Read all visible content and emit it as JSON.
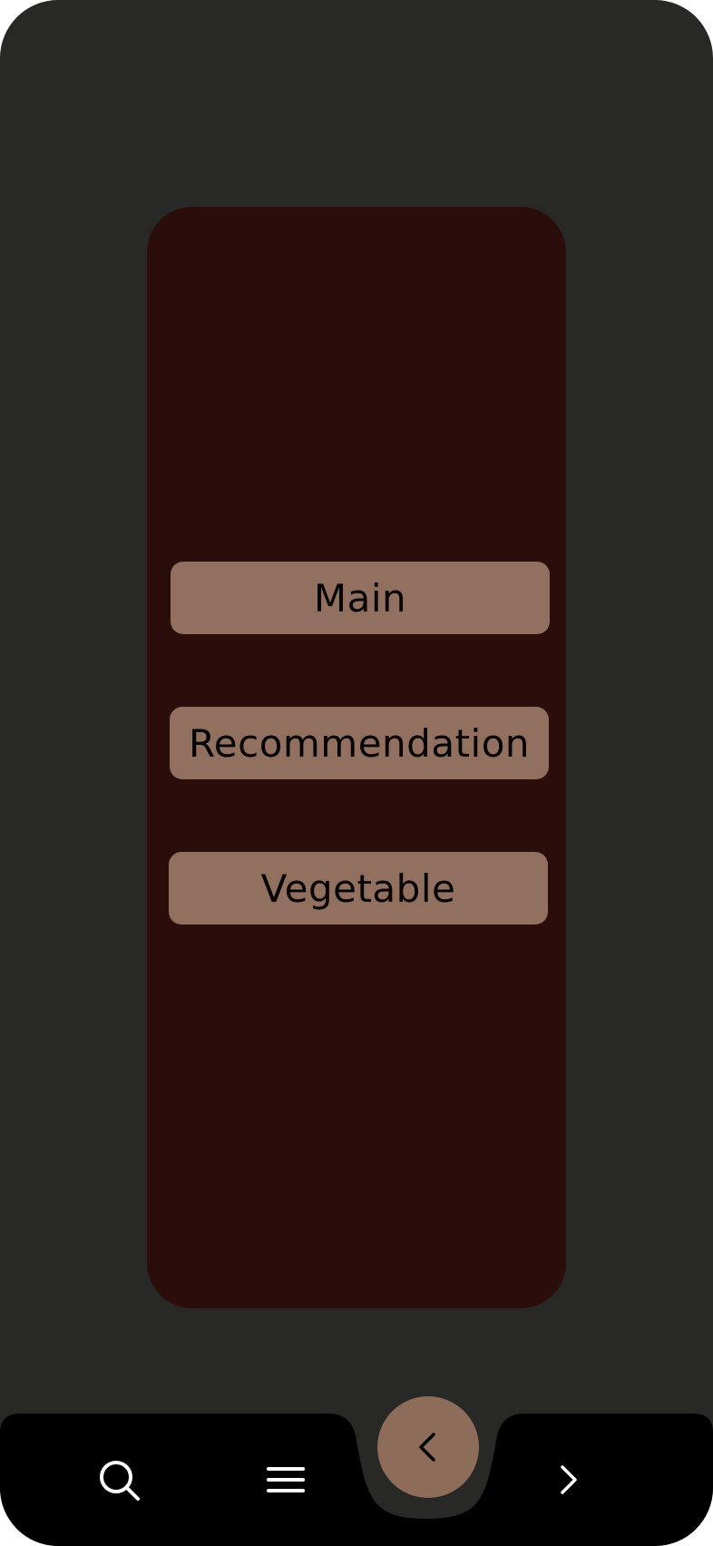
{
  "menu": {
    "buttons": [
      {
        "label": "Main"
      },
      {
        "label": "Recommendation"
      },
      {
        "label": "Vegetable"
      }
    ]
  },
  "nav": {
    "icons": [
      "search-icon",
      "menu-icon",
      "back-icon",
      "forward-icon"
    ]
  },
  "colors": {
    "background": "#282826",
    "panel": "#2b0e0c",
    "button": "#92705f",
    "button_text": "#050303",
    "navbar": "#000000",
    "fab": "#8d6c59"
  }
}
